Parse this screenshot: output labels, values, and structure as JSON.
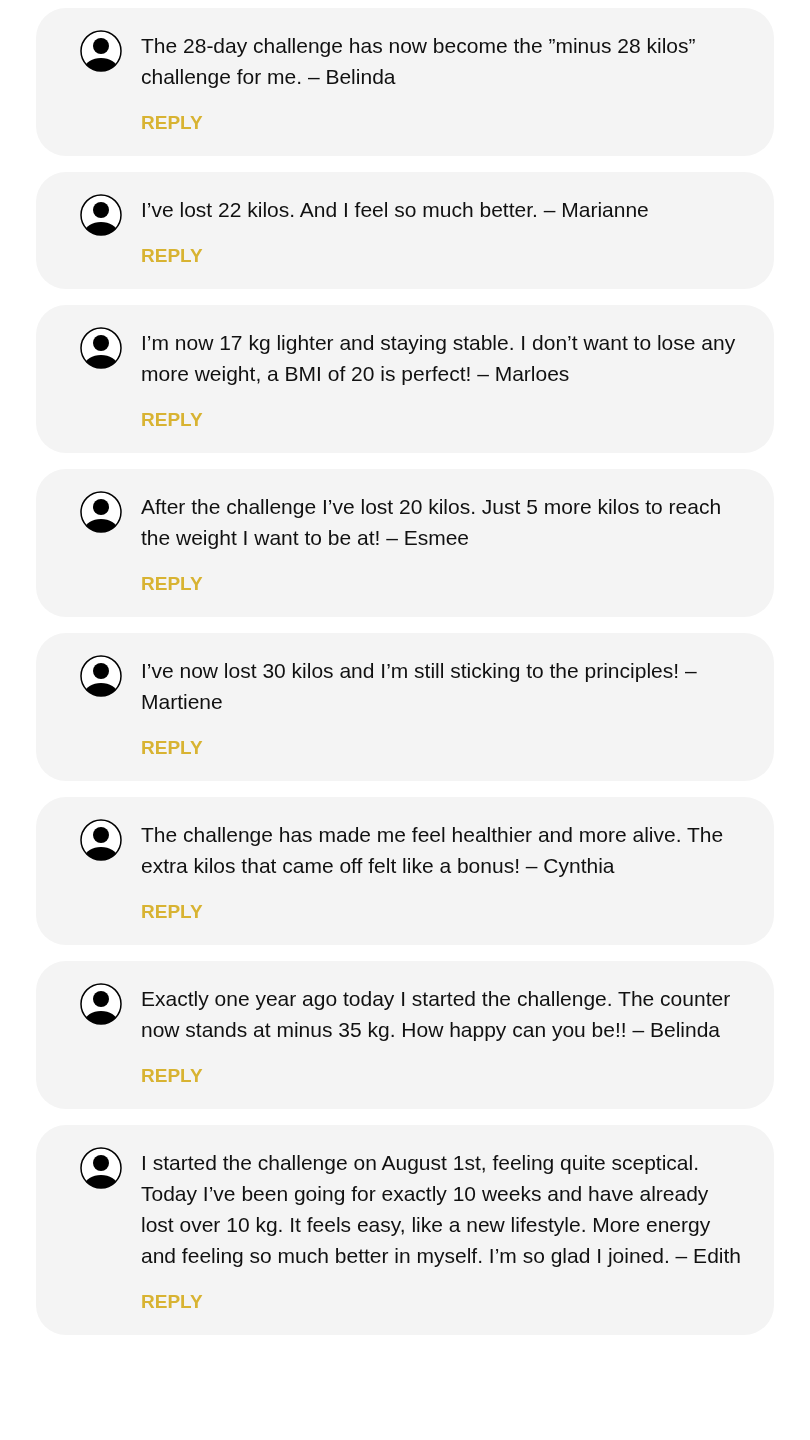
{
  "comments": [
    {
      "text": "The 28-day challenge has now become the ”minus 28 kilos” challenge for me. – Belinda",
      "reply": "REPLY"
    },
    {
      "text": "I’ve lost 22 kilos. And I feel so much better. – Marianne",
      "reply": "REPLY"
    },
    {
      "text": "I’m now 17 kg lighter and staying stable. I don’t want to lose any more weight, a BMI of 20 is perfect! – Marloes",
      "reply": "REPLY"
    },
    {
      "text": "After the challenge I’ve lost 20 kilos. Just 5 more kilos to reach the weight I want to be at! – Esmee",
      "reply": "REPLY"
    },
    {
      "text": "I’ve now lost 30 kilos and I’m still sticking to the principles! – Martiene",
      "reply": "REPLY"
    },
    {
      "text": "The challenge has made me feel healthier and more alive. The extra kilos that came off felt like a bonus! – Cynthia",
      "reply": "REPLY"
    },
    {
      "text": "Exactly one year ago today I started the challenge. The counter now stands at minus 35 kg. How happy can you be!! – Belinda",
      "reply": "REPLY"
    },
    {
      "text": "I started the challenge on August 1st, feeling quite sceptical. Today I’ve been going for exactly 10 weeks and have already lost over 10 kg. It feels easy, like a new lifestyle. More energy and feeling so much better in myself. I’m so glad I joined. – Edith",
      "reply": "REPLY"
    }
  ]
}
